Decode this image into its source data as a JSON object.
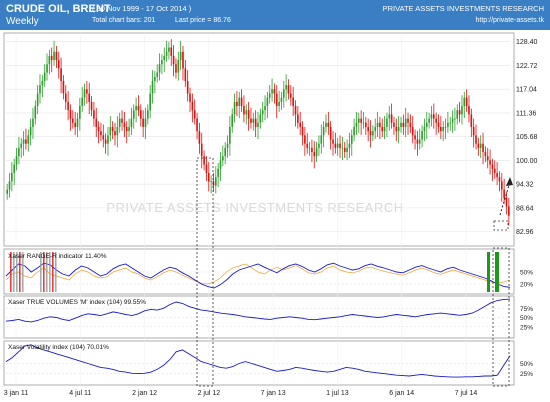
{
  "header": {
    "title": "CRUDE OIL, BRENT",
    "subtitle": "Weekly",
    "date_range": "( 30 Nov 1999 - 17 Oct 2014 )",
    "total_bars": "Total chart bars: 201",
    "last_price": "Last price = 86.76",
    "brand": "PRIVATE ASSETS INVESTMENTS RESEARCH",
    "url": "http://private-assets.tk"
  },
  "watermark": "PRIVATE ASSETS INVESTMENTS RESEARCH",
  "colors": {
    "header_bg": "#3a7fc4",
    "up_candle": "#2a9d2a",
    "down_candle": "#e01010",
    "indicator_line": "#1a1ac8",
    "orange_line": "#f0a030",
    "highlight_green": "#1a9a1a"
  },
  "chart_data": [
    {
      "type": "candlestick",
      "title": "CRUDE OIL, BRENT",
      "y_ticks": [
        "128.40",
        "122.72",
        "117.04",
        "111.36",
        "105.68",
        "100.00",
        "94.32",
        "88.64",
        "82.96"
      ],
      "ylim": [
        80,
        130
      ],
      "x_ticks": [
        "3 jan 11",
        "4 jul 11",
        "2 jan 12",
        "2 jul 12",
        "7 jan 13",
        "1 jul 13",
        "6 jan 14",
        "7 jul 14"
      ],
      "closes": [
        93,
        95,
        97,
        99,
        101,
        103,
        104,
        105,
        104,
        106,
        108,
        110,
        113,
        116,
        118,
        119,
        121,
        123,
        125,
        124,
        126,
        124,
        122,
        119,
        116,
        114,
        112,
        110,
        109,
        108,
        110,
        113,
        115,
        117,
        116,
        114,
        112,
        110,
        108,
        107,
        106,
        105,
        104,
        106,
        108,
        107,
        106,
        108,
        110,
        109,
        108,
        107,
        108,
        110,
        112,
        113,
        112,
        110,
        108,
        110,
        112,
        116,
        119,
        120,
        121,
        123,
        124,
        125,
        126,
        127,
        125,
        123,
        121,
        124,
        126,
        122,
        119,
        116,
        114,
        112,
        110,
        107,
        104,
        101,
        99,
        97,
        95,
        95,
        94,
        96,
        98,
        100,
        101,
        103,
        104,
        108,
        111,
        114,
        113,
        115,
        113,
        111,
        112,
        110,
        109,
        110,
        108,
        109,
        111,
        112,
        113,
        115,
        116,
        117,
        116,
        113,
        114,
        115,
        117,
        118,
        116,
        115,
        113,
        111,
        109,
        108,
        106,
        104,
        103,
        103,
        102,
        101,
        103,
        104,
        106,
        108,
        109,
        108,
        105,
        104,
        103,
        104,
        103,
        103,
        102,
        103,
        104,
        106,
        108,
        109,
        110,
        109,
        109,
        108,
        107,
        106,
        107,
        108,
        109,
        108,
        107,
        108,
        110,
        111,
        109,
        108,
        107,
        108,
        109,
        108,
        110,
        109,
        108,
        106,
        105,
        104,
        105,
        107,
        108,
        109,
        110,
        111,
        110,
        109,
        108,
        107,
        108,
        108,
        109,
        109,
        110,
        110,
        112,
        111,
        113,
        115,
        113,
        111,
        108,
        106,
        104,
        103,
        104,
        102,
        101,
        100,
        99,
        98,
        97,
        96,
        95,
        93,
        91,
        89,
        86.76
      ],
      "annotations": [
        "dashed box at 2 jul 12",
        "dashed box at latest bar",
        "dashed arrow up from latest bar"
      ]
    },
    {
      "type": "line",
      "title": "Xaser RANGE-R indicator",
      "value": "11.40%",
      "y_ticks": [
        "50%",
        "20%"
      ],
      "ylim": [
        0,
        100
      ],
      "series": [
        {
          "color": "#1a1ac8",
          "values": [
            40,
            55,
            70,
            65,
            50,
            60,
            72,
            68,
            55,
            45,
            40,
            55,
            65,
            60,
            50,
            40,
            45,
            58,
            66,
            70,
            60,
            50,
            40,
            35,
            45,
            55,
            62,
            58,
            48,
            40,
            30,
            20,
            14,
            10,
            18,
            30,
            45,
            55,
            60,
            65,
            70,
            62,
            55,
            48,
            58,
            66,
            70,
            64,
            55,
            50,
            58,
            68,
            72,
            65,
            60,
            55,
            58,
            66,
            70,
            64,
            60,
            55,
            50,
            48,
            55,
            62,
            66,
            60,
            55,
            50,
            58,
            62,
            55,
            50,
            45,
            40,
            35,
            28,
            20,
            14,
            11.4
          ]
        },
        {
          "color": "#f0a030",
          "values": [
            30,
            45,
            50,
            40,
            35,
            50,
            60,
            45,
            40,
            35,
            30,
            45,
            55,
            50,
            40,
            35,
            38,
            50,
            55,
            60,
            50,
            45,
            35,
            30,
            38,
            48,
            55,
            50,
            42,
            35,
            28,
            22,
            20,
            25,
            35,
            50,
            60,
            65,
            70,
            60,
            50,
            45,
            55,
            62,
            55,
            60,
            66,
            58,
            48,
            45,
            50,
            60,
            65,
            55,
            50,
            48,
            52,
            60,
            62,
            56,
            52,
            48,
            45,
            42,
            48,
            55,
            60,
            55,
            48,
            44,
            50,
            55,
            50,
            45,
            40,
            35,
            30,
            25,
            22,
            25,
            30
          ]
        }
      ],
      "highlight_bars": [
        "early 2011 grey/red bars",
        "latest bars green"
      ]
    },
    {
      "type": "line",
      "title": "Xaser TRUE VOLUMES 'M' index",
      "period": "(104)",
      "value": "99.55%",
      "y_ticks": [
        "75%",
        "50%",
        "25%"
      ],
      "ylim": [
        0,
        100
      ],
      "series": [
        {
          "color": "#1a1ac8",
          "values": [
            40,
            42,
            45,
            40,
            38,
            42,
            48,
            52,
            50,
            45,
            42,
            48,
            55,
            60,
            58,
            55,
            60,
            65,
            62,
            58,
            55,
            60,
            68,
            72,
            70,
            75,
            85,
            92,
            88,
            80,
            75,
            70,
            68,
            65,
            62,
            60,
            58,
            55,
            52,
            50,
            48,
            46,
            45,
            48,
            50,
            52,
            50,
            48,
            45,
            44,
            46,
            48,
            50,
            52,
            55,
            58,
            56,
            54,
            52,
            50,
            52,
            55,
            58,
            56,
            54,
            52,
            55,
            58,
            60,
            62,
            60,
            58,
            56,
            58,
            62,
            70,
            80,
            90,
            96,
            99,
            99.55
          ]
        }
      ]
    },
    {
      "type": "line",
      "title": "Xaser Volatility index",
      "period": "(104)",
      "value": "70.01%",
      "y_ticks": [
        "50%",
        "25%"
      ],
      "ylim": [
        0,
        100
      ],
      "series": [
        {
          "color": "#1a1ac8",
          "values": [
            55,
            65,
            80,
            95,
            98,
            90,
            85,
            80,
            75,
            70,
            65,
            60,
            55,
            50,
            45,
            40,
            38,
            35,
            30,
            28,
            25,
            24,
            25,
            28,
            35,
            45,
            60,
            80,
            85,
            75,
            65,
            55,
            50,
            45,
            40,
            38,
            42,
            50,
            55,
            50,
            45,
            40,
            35,
            30,
            32,
            35,
            40,
            38,
            35,
            32,
            30,
            28,
            30,
            35,
            40,
            38,
            35,
            30,
            28,
            26,
            24,
            22,
            20,
            19,
            18,
            20,
            22,
            20,
            18,
            17,
            16,
            15,
            15,
            16,
            16,
            17,
            18,
            18,
            20,
            45,
            70
          ]
        }
      ]
    }
  ]
}
